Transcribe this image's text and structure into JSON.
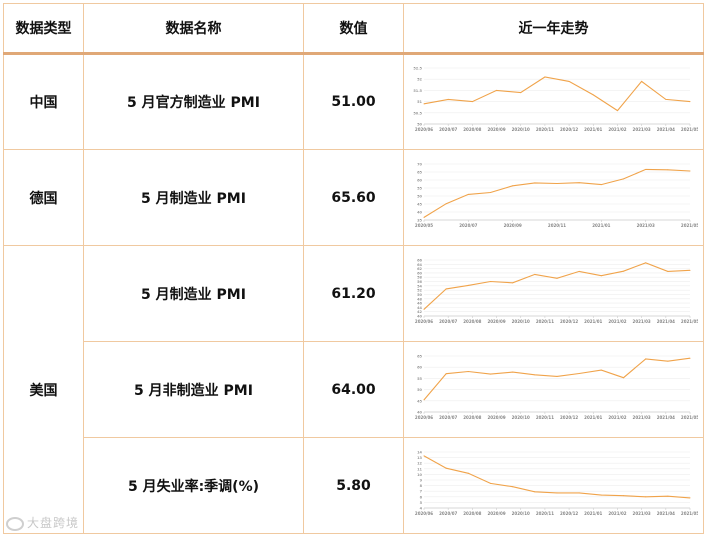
{
  "header": {
    "type": "数据类型",
    "name": "数据名称",
    "value": "数值",
    "trend": "近一年走势"
  },
  "rows": {
    "cn": {
      "type": "中国",
      "name": "5 月官方制造业 PMI",
      "value": "51.00"
    },
    "de": {
      "type": "德国",
      "name": "5 月制造业 PMI",
      "value": "65.60"
    },
    "us": {
      "type": "美国"
    },
    "us1": {
      "name": "5 月制造业 PMI",
      "value": "61.20"
    },
    "us2": {
      "name": "5 月非制造业 PMI",
      "value": "64.00"
    },
    "us3": {
      "name": "5 月失业率:季调(%)",
      "value": "5.80"
    }
  },
  "watermark": "大盘跨境",
  "line_color": "#f0a34a",
  "chart_data": [
    {
      "type": "line",
      "id": "cn",
      "x": [
        "2020/06",
        "2020/07",
        "2020/08",
        "2020/09",
        "2020/10",
        "2020/11",
        "2020/12",
        "2021/01",
        "2021/02",
        "2021/03",
        "2021/04",
        "2021/05"
      ],
      "tick_labels": [
        "2020/06",
        "2020/07",
        "2020/08",
        "2020/09",
        "2020/10",
        "2020/11",
        "2020/12",
        "2021/01",
        "2021/02",
        "2021/03",
        "2021/04",
        "2021/05"
      ],
      "values": [
        50.9,
        51.1,
        51.0,
        51.5,
        51.4,
        52.1,
        51.9,
        51.3,
        50.6,
        51.9,
        51.1,
        51.0
      ],
      "ylim": [
        50.0,
        52.5
      ],
      "yticks": [
        50.0,
        50.5,
        51.0,
        51.5,
        52.0,
        52.5
      ]
    },
    {
      "type": "line",
      "id": "de",
      "x": [
        "2020/05",
        "2020/06",
        "2020/07",
        "2020/08",
        "2020/09",
        "2020/10",
        "2020/11",
        "2020/12",
        "2021/01",
        "2021/02",
        "2021/03",
        "2021/04",
        "2021/05"
      ],
      "tick_labels": [
        "2020/05",
        "2020/07",
        "2020/09",
        "2020/11",
        "2021/01",
        "2021/03",
        "2021/05"
      ],
      "values": [
        36.6,
        45.2,
        51.0,
        52.2,
        56.4,
        58.2,
        57.8,
        58.3,
        57.1,
        60.7,
        66.6,
        66.4,
        65.6
      ],
      "ylim": [
        35,
        70
      ],
      "yticks": [
        35,
        40,
        45,
        50,
        55,
        60,
        65,
        70
      ]
    },
    {
      "type": "line",
      "id": "us1",
      "x": [
        "2020/05",
        "2020/06",
        "2020/07",
        "2020/08",
        "2020/09",
        "2020/10",
        "2020/11",
        "2020/12",
        "2021/01",
        "2021/02",
        "2021/03",
        "2021/04",
        "2021/05"
      ],
      "tick_labels": [
        "2020/06",
        "2020/07",
        "2020/08",
        "2020/09",
        "2020/10",
        "2020/11",
        "2020/12",
        "2021/01",
        "2021/02",
        "2021/03",
        "2021/04",
        "2021/05"
      ],
      "values": [
        43.1,
        52.6,
        54.2,
        56.0,
        55.4,
        59.3,
        57.5,
        60.7,
        58.7,
        60.8,
        64.7,
        60.7,
        61.2
      ],
      "ylim": [
        40,
        66
      ],
      "yticks": [
        40,
        42,
        44,
        46,
        48,
        50,
        52,
        54,
        56,
        58,
        60,
        62,
        64,
        66
      ]
    },
    {
      "type": "line",
      "id": "us2",
      "x": [
        "2020/05",
        "2020/06",
        "2020/07",
        "2020/08",
        "2020/09",
        "2020/10",
        "2020/11",
        "2020/12",
        "2021/01",
        "2021/02",
        "2021/03",
        "2021/04",
        "2021/05"
      ],
      "tick_labels": [
        "2020/06",
        "2020/07",
        "2020/08",
        "2020/09",
        "2020/10",
        "2020/11",
        "2020/12",
        "2021/01",
        "2021/02",
        "2021/03",
        "2021/04",
        "2021/05"
      ],
      "values": [
        45.4,
        57.1,
        58.1,
        56.9,
        57.8,
        56.6,
        55.9,
        57.2,
        58.7,
        55.3,
        63.7,
        62.7,
        64.0
      ],
      "ylim": [
        40,
        65
      ],
      "yticks": [
        40,
        45,
        50,
        55,
        60,
        65
      ]
    },
    {
      "type": "line",
      "id": "us3",
      "x": [
        "2020/05",
        "2020/06",
        "2020/07",
        "2020/08",
        "2020/09",
        "2020/10",
        "2020/11",
        "2020/12",
        "2021/01",
        "2021/02",
        "2021/03",
        "2021/04",
        "2021/05"
      ],
      "tick_labels": [
        "2020/06",
        "2020/07",
        "2020/08",
        "2020/09",
        "2020/10",
        "2020/11",
        "2020/12",
        "2021/01",
        "2021/02",
        "2021/03",
        "2021/04",
        "2021/05"
      ],
      "values": [
        13.3,
        11.1,
        10.2,
        8.4,
        7.8,
        6.9,
        6.7,
        6.7,
        6.3,
        6.2,
        6.0,
        6.1,
        5.8
      ],
      "ylim": [
        4,
        14
      ],
      "yticks": [
        4,
        5,
        6,
        7,
        8,
        9,
        10,
        11,
        12,
        13,
        14
      ]
    }
  ]
}
